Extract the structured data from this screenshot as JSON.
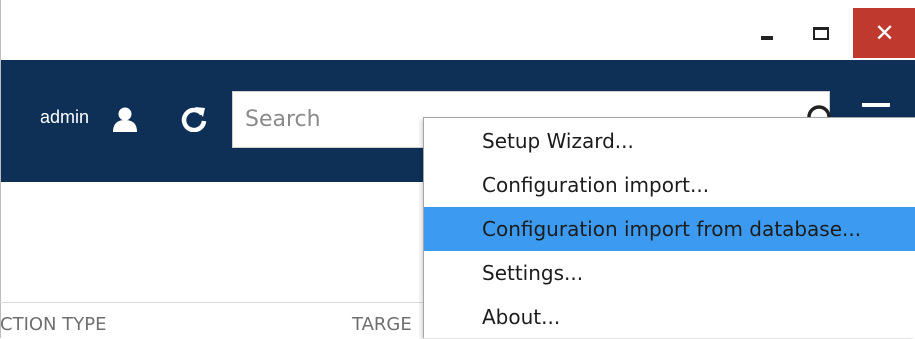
{
  "window": {
    "controls": {
      "minimize_icon": "minimize-icon",
      "maximize_icon": "maximize-icon",
      "close_icon": "close-icon",
      "close_glyph": "✕"
    }
  },
  "header": {
    "username": "admin",
    "user_icon": "user-icon",
    "refresh_icon": "refresh-icon",
    "search": {
      "placeholder": "Search",
      "value": ""
    },
    "search_icon": "search-icon",
    "menu_icon": "hamburger-menu-icon",
    "background_color": "#0e3057"
  },
  "table": {
    "columns": [
      "CTION TYPE",
      "TARGE"
    ]
  },
  "dropdown_menu": {
    "items": [
      {
        "label": "Setup Wizard..."
      },
      {
        "label": "Configuration import..."
      },
      {
        "label": "Configuration import from database...",
        "highlighted": true
      },
      {
        "label": "Settings..."
      },
      {
        "label": "About..."
      }
    ],
    "highlight_color": "#3c9bf0"
  }
}
